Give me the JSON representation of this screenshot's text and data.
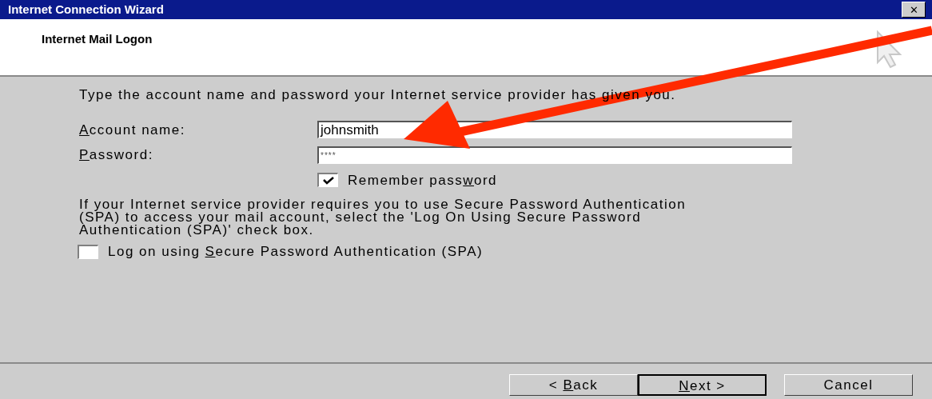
{
  "window": {
    "title": "Internet Connection Wizard",
    "close_glyph": "✕"
  },
  "header": {
    "title": "Internet Mail Logon"
  },
  "instruction": "Type the account name and password your Internet service provider has given you.",
  "fields": [
    {
      "label": "Account name:",
      "value": "johnsmith",
      "kind": "text"
    },
    {
      "label": "Password:",
      "value": "****",
      "kind": "password"
    }
  ],
  "remember_password": {
    "label": "Remember password",
    "checked": true
  },
  "spa_note": "If your Internet service provider requires you to use Secure Password Authentication (SPA) to access your mail account, select the 'Log On Using Secure Password Authentication (SPA)' check box.",
  "spa_checkbox": {
    "label": "Log on using Secure Password Authentication (SPA)",
    "checked": false
  },
  "buttons": [
    {
      "label": "< Back",
      "default": false
    },
    {
      "label": "Next >",
      "default": true
    },
    {
      "label": "Cancel",
      "default": false
    }
  ]
}
